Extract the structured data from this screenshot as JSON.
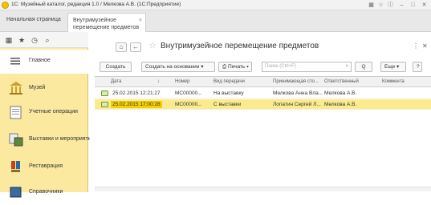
{
  "window": {
    "title": "1С: Музейный каталог, редакция 1.0 / Мелкова А.В. (1С:Предприятие)"
  },
  "tabs": {
    "home": "Начальная страница",
    "active": "Внутримузейное перемещение предметов",
    "close": "×"
  },
  "sidebar": {
    "items": [
      {
        "label": "Главное",
        "icon": "lines-icon"
      },
      {
        "label": "Музей",
        "icon": "museum-icon"
      },
      {
        "label": "Учетные операции",
        "icon": "ledger-icon"
      },
      {
        "label": "Выставки и мероприятия",
        "icon": "exhibition-icon"
      },
      {
        "label": "Реставрация",
        "icon": "brush-icon"
      },
      {
        "label": "Справочники",
        "icon": "book-icon"
      }
    ]
  },
  "header": {
    "title": "Внутримузейное перемещение предметов",
    "nav_back": "←",
    "nav_forward": "→",
    "home_btn": "⌂"
  },
  "toolbar": {
    "create": "Создать",
    "create_based": "Создать на основании",
    "print": "Печать",
    "search_placeholder": "Поиск (Ctrl+F)",
    "search_clear": "×",
    "search_btn": "Q",
    "more": "Еще",
    "help": "?"
  },
  "table": {
    "columns": [
      "Дата",
      "Номер",
      "Вид передачи",
      "Принимающая сто...",
      "Ответственный",
      "Коммента"
    ],
    "sort_marker": "↓",
    "rows": [
      {
        "date": "25.02.2015 12:21:27",
        "number": "МС00000...",
        "kind": "На выставку",
        "receiver": "Мелкова Анна Вла...",
        "responsible": "Мелкова А.В.",
        "comment": ""
      },
      {
        "date": "25.02.2015 17:00:28",
        "number": "МС00000...",
        "kind": "С выставки",
        "receiver": "Лопатин Сергей Л...",
        "responsible": "Мелкова А.В.",
        "comment": ""
      }
    ]
  },
  "colors": {
    "accent": "#f5d000",
    "sidebar_bg": "#fbe9a0",
    "selected_row": "#fbeb8c"
  }
}
